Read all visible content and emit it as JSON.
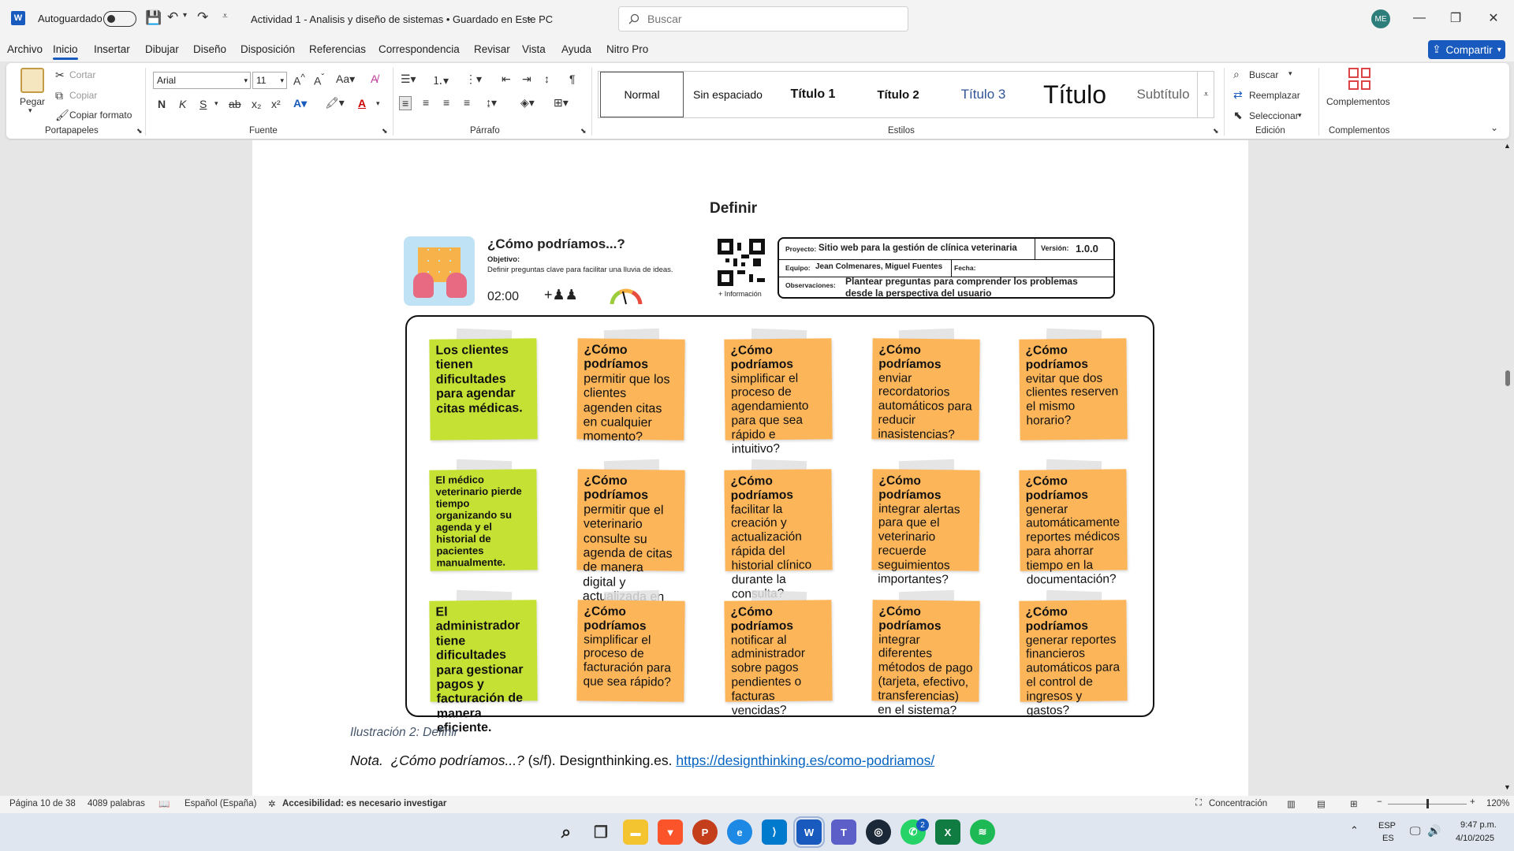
{
  "titlebar": {
    "autosave_label": "Autoguardado",
    "doc_title": "Actividad 1 - Analisis y diseño de sistemas • Guardado en Este PC",
    "search_placeholder": "Buscar",
    "avatar_initials": "ME"
  },
  "menu": {
    "items": [
      "Archivo",
      "Inicio",
      "Insertar",
      "Dibujar",
      "Diseño",
      "Disposición",
      "Referencias",
      "Correspondencia",
      "Revisar",
      "Vista",
      "Ayuda",
      "Nitro Pro"
    ],
    "active": "Inicio",
    "share_label": "Compartir"
  },
  "ribbon": {
    "clipboard": {
      "paste": "Pegar",
      "cut": "Cortar",
      "copy": "Copiar",
      "format_painter": "Copiar formato",
      "group": "Portapapeles"
    },
    "font": {
      "name": "Arial",
      "size": "11",
      "group": "Fuente"
    },
    "paragraph": {
      "group": "Párrafo"
    },
    "styles": {
      "items": [
        "Normal",
        "Sin espaciado",
        "Título 1",
        "Título 2",
        "Título 3",
        "Título",
        "Subtítulo"
      ],
      "group": "Estilos"
    },
    "editing": {
      "find": "Buscar",
      "replace": "Reemplazar",
      "select": "Seleccionar",
      "group": "Edición"
    },
    "addins": {
      "label": "Complementos",
      "group": "Complementos"
    }
  },
  "document": {
    "heading": "Definir",
    "template": {
      "title": "¿Cómo podríamos...?",
      "objective_label": "Objetivo:",
      "objective_text": "Definir preguntas clave para facilitar una lluvia de ideas.",
      "time": "02:00",
      "qr_caption": "+ Información",
      "project_label": "Proyecto:",
      "project_value": "Sitio web para la gestión de clínica veterinaria",
      "version_label": "Versión:",
      "version_value": "1.0.0",
      "team_label": "Equipo:",
      "team_value": "Jean Colmenares, Miguel Fuentes",
      "date_label": "Fecha:",
      "obs_label": "Observaciones:",
      "obs_value_1": "Plantear preguntas para comprender los problemas",
      "obs_value_2": "desde la perspectiva del usuario"
    },
    "notes": [
      [
        "Los clientes tienen dificultades para agendar citas médicas.",
        "¿Cómo podríamos permitir que los clientes agenden citas en cualquier momento?",
        "¿Cómo podríamos simplificar el proceso de agendamiento para que sea rápido e intuitivo?",
        "¿Cómo podríamos enviar recordatorios automáticos para reducir inasistencias?",
        "¿Cómo podríamos evitar que dos clientes reserven el mismo horario?"
      ],
      [
        "El médico veterinario pierde tiempo organizando su agenda y el historial de pacientes manualmente.",
        "¿Cómo podríamos permitir que el veterinario consulte su agenda de citas de manera digital y actualizada en tiempo real?",
        "¿Cómo podríamos facilitar la creación y actualización rápida del historial clínico durante la consulta?",
        "¿Cómo podríamos integrar alertas para que el veterinario recuerde seguimientos importantes?",
        "¿Cómo podríamos generar automáticamente reportes médicos para ahorrar tiempo en la documentación?"
      ],
      [
        "El administrador tiene dificultades para gestionar pagos y facturación de manera eficiente.",
        "¿Cómo podríamos simplificar el proceso de facturación para que sea rápido?",
        "¿Cómo podríamos notificar al administrador sobre pagos pendientes o facturas vencidas?",
        "¿Cómo podríamos integrar diferentes métodos de pago (tarjeta, efectivo, transferencias) en el sistema?",
        "¿Cómo podríamos generar reportes financieros automáticos para el control de ingresos y gastos?"
      ]
    ],
    "caption": "Ilustración 2: Definir",
    "nota_prefix": "Nota.",
    "nota_title": "¿Cómo podríamos...?",
    "nota_rest": " (s/f). Designthinking.es. ",
    "nota_link": "https://designthinking.es/como-podriamos/"
  },
  "status": {
    "page": "Página 10 de 38",
    "words": "4089 palabras",
    "language": "Español (España)",
    "accessibility": "Accesibilidad: es necesario investigar",
    "focus": "Concentración",
    "zoom": "120%"
  },
  "taskbar": {
    "lang": "ESP",
    "lang_sub": "ES",
    "time": "9:47 p.m.",
    "date": "4/10/2025",
    "whatsapp_badge": "2"
  },
  "colors": {
    "accent": "#185abd",
    "note_green": "#c5e234",
    "note_orange": "#fdb55a"
  }
}
